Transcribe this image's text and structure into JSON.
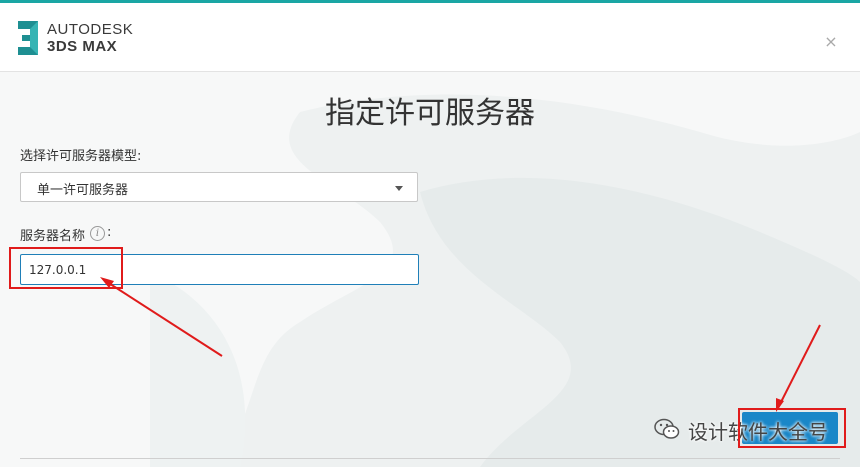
{
  "window": {
    "brand_line1": "AUTODESK",
    "brand_line2": "3DS MAX",
    "close_glyph": "×",
    "logo_icon": "3ds-max-logo-icon",
    "close_icon": "close-icon"
  },
  "page": {
    "title": "指定许可服务器"
  },
  "form": {
    "model_label": "选择许可服务器模型:",
    "model_select_value": "单一许可服务器",
    "server_name_label": "服务器名称",
    "server_name_suffix": ":",
    "server_name_value": "127.0.0.1",
    "info_glyph": "i"
  },
  "watermark": {
    "text": "设计软件大全号",
    "icon": "wechat-icon"
  },
  "colors": {
    "accent": "#1aa6a4",
    "button": "#1a87c8",
    "annotation_red": "#e01b1b",
    "input_border": "#1f7fb8"
  }
}
